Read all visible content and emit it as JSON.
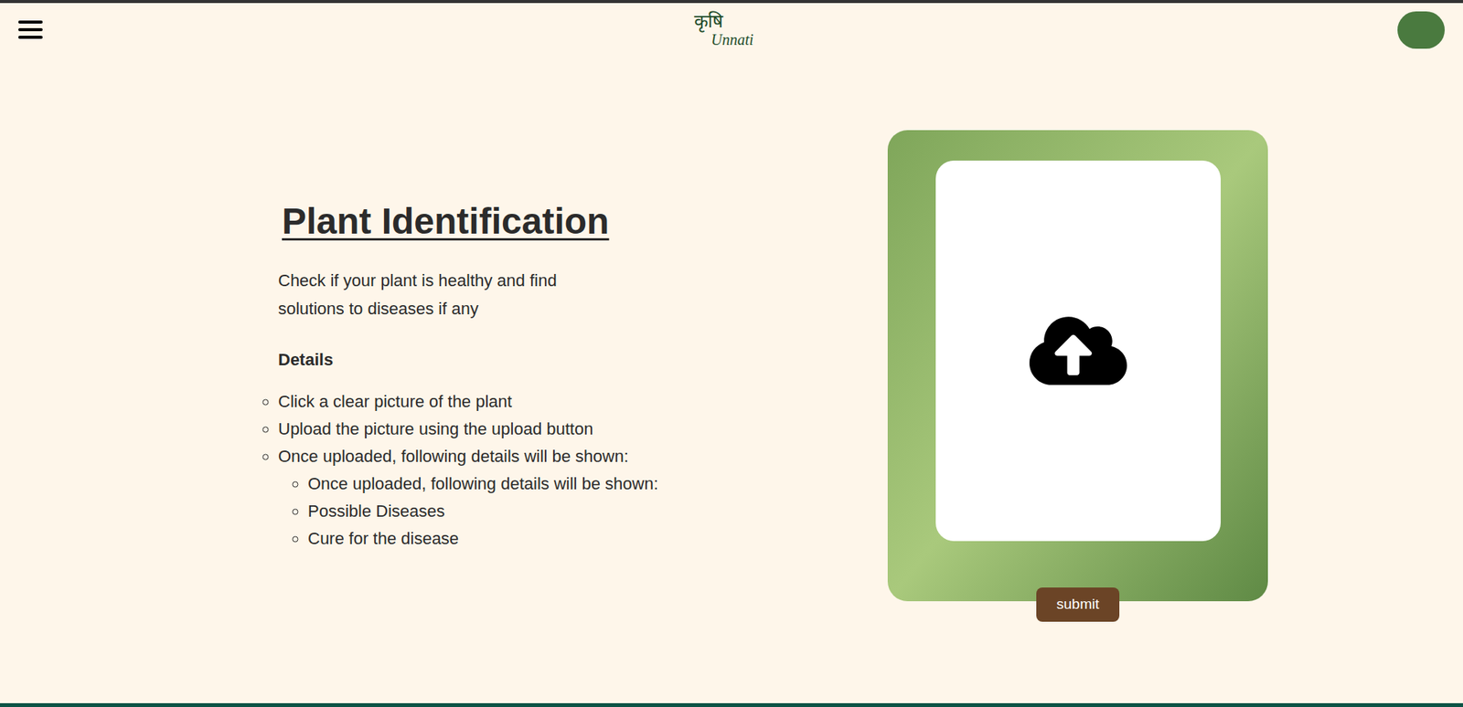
{
  "logo": {
    "script": "कृषि",
    "name": "Unnati"
  },
  "page": {
    "title": "Plant Identification",
    "description": "Check if your plant is healthy and find solutions to diseases if any",
    "details_heading": "Details",
    "steps": [
      {
        "text": "Click a clear picture of the plant",
        "children": []
      },
      {
        "text": "Upload the picture using the upload button",
        "children": []
      },
      {
        "text": "Once uploaded, following details will be shown:",
        "children": [
          "Once uploaded, following details will be shown:",
          "Possible Diseases",
          "Cure for the disease"
        ]
      }
    ]
  },
  "upload": {
    "submit_label": "submit"
  }
}
